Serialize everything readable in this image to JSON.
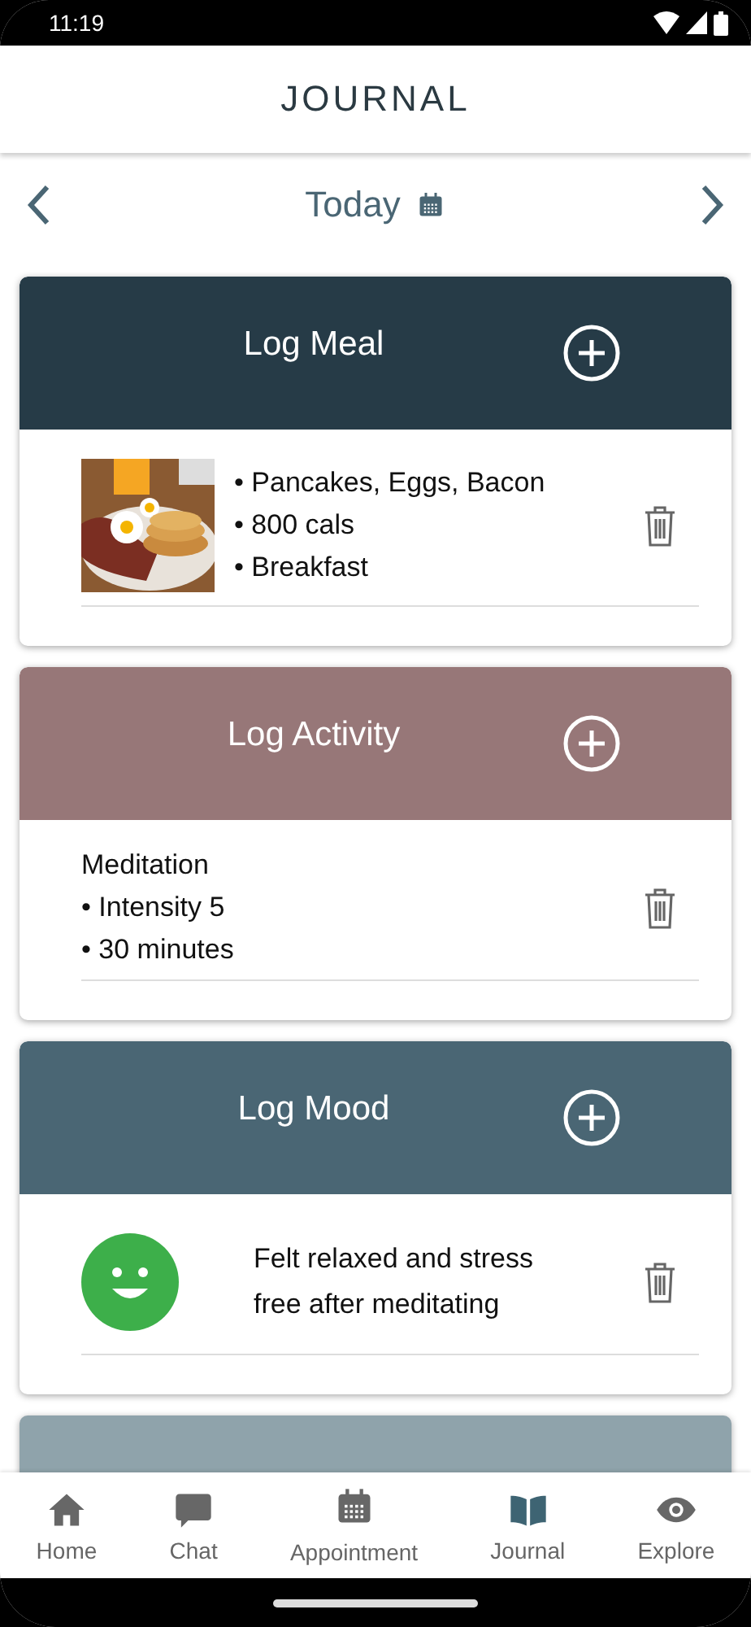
{
  "status_bar": {
    "time": "11:19"
  },
  "app_bar": {
    "title": "JOURNAL"
  },
  "date_nav": {
    "label": "Today"
  },
  "cards": [
    {
      "title": "Log Meal",
      "color": "#263b47",
      "entry": {
        "kind": "meal",
        "lines": [
          "• Pancakes, Eggs, Bacon",
          "• 800 cals",
          "• Breakfast"
        ]
      }
    },
    {
      "title": "Log Activity",
      "color": "#977778",
      "entry": {
        "kind": "activity",
        "lines": [
          "Meditation",
          "• Intensity 5",
          "• 30 minutes"
        ]
      }
    },
    {
      "title": "Log Mood",
      "color": "#4a6674",
      "entry": {
        "kind": "mood",
        "lines": [
          "Felt relaxed and stress free after meditating"
        ]
      }
    },
    {
      "color": "#8fa3ab"
    }
  ],
  "bottom_nav": [
    {
      "label": "Home",
      "kind": "home",
      "selected": false
    },
    {
      "label": "Chat",
      "kind": "chat",
      "selected": false
    },
    {
      "label": "Appointment",
      "kind": "calendar",
      "selected": false
    },
    {
      "label": "Journal",
      "kind": "book",
      "selected": true
    },
    {
      "label": "Explore",
      "kind": "eye",
      "selected": false
    }
  ]
}
